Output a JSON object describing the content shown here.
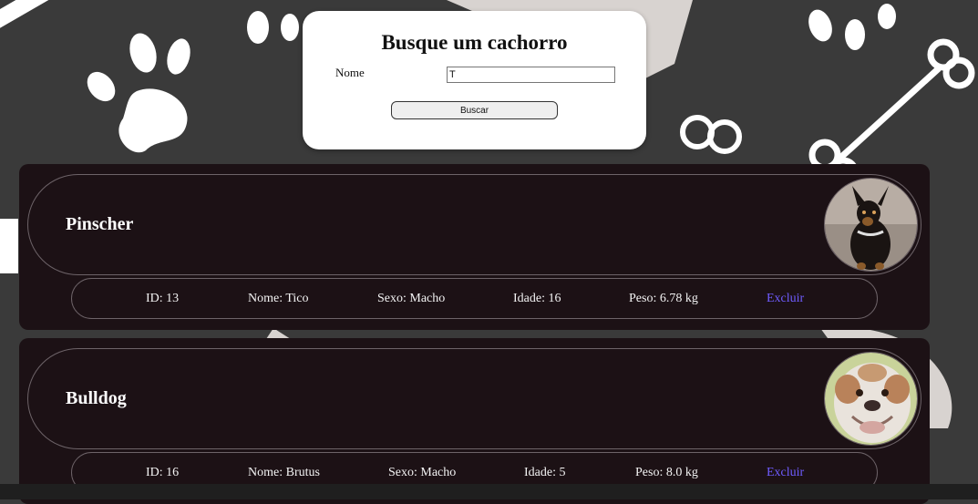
{
  "search": {
    "title": "Busque um cachorro",
    "name_label": "Nome",
    "name_value": "T",
    "button_label": "Buscar"
  },
  "dogs": [
    {
      "breed": "Pinscher",
      "photo": "pinscher-photo",
      "id_text": "ID: 13",
      "name_text": "Nome: Tico",
      "sex_text": "Sexo: Macho",
      "age_text": "Idade: 16",
      "weight_text": "Peso: 6.78 kg",
      "delete_label": "Excluir"
    },
    {
      "breed": "Bulldog",
      "photo": "bulldog-photo",
      "id_text": "ID: 16",
      "name_text": "Nome: Brutus",
      "sex_text": "Sexo: Macho",
      "age_text": "Idade: 5",
      "weight_text": "Peso: 8.0 kg",
      "delete_label": "Excluir"
    }
  ],
  "colors": {
    "background": "#3a3a3a",
    "card": "#1c1115",
    "link": "#6f5cff"
  }
}
